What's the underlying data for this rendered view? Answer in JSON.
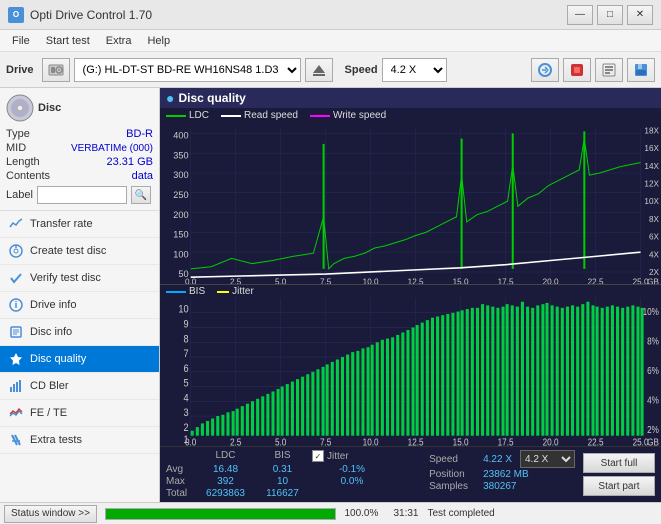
{
  "titlebar": {
    "title": "Opti Drive Control 1.70",
    "icon": "ODC",
    "min_btn": "—",
    "max_btn": "□",
    "close_btn": "✕"
  },
  "menubar": {
    "items": [
      "File",
      "Start test",
      "Extra",
      "Help"
    ]
  },
  "toolbar": {
    "drive_label": "Drive",
    "drive_value": "(G:)  HL-DT-ST BD-RE  WH16NS48 1.D3",
    "speed_label": "Speed",
    "speed_value": "4.2 X"
  },
  "disc": {
    "type_label": "Type",
    "type_value": "BD-R",
    "mid_label": "MID",
    "mid_value": "VERBATIMe (000)",
    "length_label": "Length",
    "length_value": "23.31 GB",
    "contents_label": "Contents",
    "contents_value": "data",
    "label_label": "Label"
  },
  "nav": {
    "items": [
      {
        "id": "transfer-rate",
        "label": "Transfer rate",
        "icon": "📈"
      },
      {
        "id": "create-test-disc",
        "label": "Create test disc",
        "icon": "💿"
      },
      {
        "id": "verify-test-disc",
        "label": "Verify test disc",
        "icon": "✓"
      },
      {
        "id": "drive-info",
        "label": "Drive info",
        "icon": "ℹ"
      },
      {
        "id": "disc-info",
        "label": "Disc info",
        "icon": "📋"
      },
      {
        "id": "disc-quality",
        "label": "Disc quality",
        "icon": "★",
        "active": true
      },
      {
        "id": "cd-bler",
        "label": "CD Bler",
        "icon": "📊"
      },
      {
        "id": "fe-te",
        "label": "FE / TE",
        "icon": "📉"
      },
      {
        "id": "extra-tests",
        "label": "Extra tests",
        "icon": "🔧"
      }
    ]
  },
  "chart": {
    "title": "Disc quality",
    "icon": "●",
    "legend": [
      {
        "id": "ldc",
        "label": "LDC",
        "color": "#00cc00"
      },
      {
        "id": "read-speed",
        "label": "Read speed",
        "color": "#ffffff"
      },
      {
        "id": "write-speed",
        "label": "Write speed",
        "color": "#ff00ff"
      }
    ],
    "legend2": [
      {
        "id": "bis",
        "label": "BIS",
        "color": "#00aaff"
      },
      {
        "id": "jitter",
        "label": "Jitter",
        "color": "#ffff00"
      }
    ],
    "top_y_labels": [
      "400",
      "350",
      "300",
      "250",
      "200",
      "150",
      "100",
      "50"
    ],
    "top_y_right": [
      "18X",
      "16X",
      "14X",
      "12X",
      "10X",
      "8X",
      "6X",
      "4X",
      "2X"
    ],
    "bottom_y_labels": [
      "10",
      "9",
      "8",
      "7",
      "6",
      "5",
      "4",
      "3",
      "2",
      "1"
    ],
    "bottom_y_right": [
      "10%",
      "8%",
      "6%",
      "4%",
      "2%"
    ],
    "x_labels": [
      "0.0",
      "2.5",
      "5.0",
      "7.5",
      "10.0",
      "12.5",
      "15.0",
      "17.5",
      "20.0",
      "22.5",
      "25.0"
    ],
    "x_unit": "GB"
  },
  "stats": {
    "columns": [
      "LDC",
      "BIS",
      "",
      "Jitter",
      "Speed",
      ""
    ],
    "avg_label": "Avg",
    "avg_ldc": "16.48",
    "avg_bis": "0.31",
    "avg_jitter": "-0.1%",
    "max_label": "Max",
    "max_ldc": "392",
    "max_bis": "10",
    "max_jitter": "0.0%",
    "total_label": "Total",
    "total_ldc": "6293863",
    "total_bis": "116627",
    "speed_label": "Speed",
    "speed_value": "4.22 X",
    "position_label": "Position",
    "position_value": "23862 MB",
    "samples_label": "Samples",
    "samples_value": "380267",
    "speed_select": "4.2 X"
  },
  "buttons": {
    "start_full": "Start full",
    "start_part": "Start part",
    "status_window": "Status window >>"
  },
  "statusbar": {
    "text": "Test completed",
    "progress": 100,
    "progress_text": "100.0%",
    "time": "31:31"
  }
}
